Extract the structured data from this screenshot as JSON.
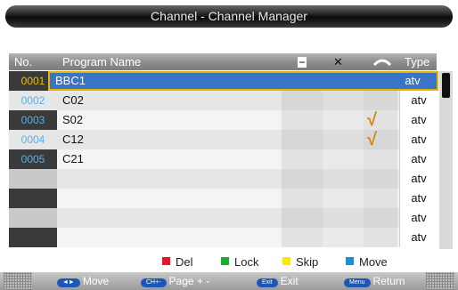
{
  "title": "Channel - Channel Manager",
  "header": {
    "no": "No.",
    "program_name": "Program Name",
    "lock_icon": "lock-icon",
    "delete_icon": "delete-icon",
    "skip_icon": "skip-icon",
    "delete_label": "✕",
    "type": "Type"
  },
  "rows": [
    {
      "no": "0001",
      "name": "BBC1",
      "type": "atv",
      "skip": "",
      "selected": true
    },
    {
      "no": "0002",
      "name": "C02",
      "type": "atv",
      "skip": ""
    },
    {
      "no": "0003",
      "name": "S02",
      "type": "atv",
      "skip": "√"
    },
    {
      "no": "0004",
      "name": "C12",
      "type": "atv",
      "skip": "√"
    },
    {
      "no": "0005",
      "name": "C21",
      "type": "atv",
      "skip": ""
    },
    {
      "no": "",
      "name": "",
      "type": "atv",
      "skip": ""
    },
    {
      "no": "",
      "name": "",
      "type": "atv",
      "skip": ""
    },
    {
      "no": "",
      "name": "",
      "type": "atv",
      "skip": ""
    },
    {
      "no": "",
      "name": "",
      "type": "atv",
      "skip": ""
    }
  ],
  "legend": {
    "del": "Del",
    "lock": "Lock",
    "skip": "Skip",
    "move": "Move"
  },
  "legend_colors": {
    "del": "#e8142a",
    "lock": "#1aae2c",
    "skip": "#ffe800",
    "move": "#1a8fd8"
  },
  "footer": {
    "move_key": "◄►",
    "move": "Move",
    "page_key": "CH+-",
    "page": "Page + -",
    "exit_key": "Exit",
    "exit": "Exit",
    "return_key": "Menu",
    "return": "Return"
  },
  "colors": {
    "selected_row": "#3a74c4",
    "selection_border": "#e8b200",
    "number_cell": "#3a3a3a",
    "number_text": "#5ab0e8"
  }
}
